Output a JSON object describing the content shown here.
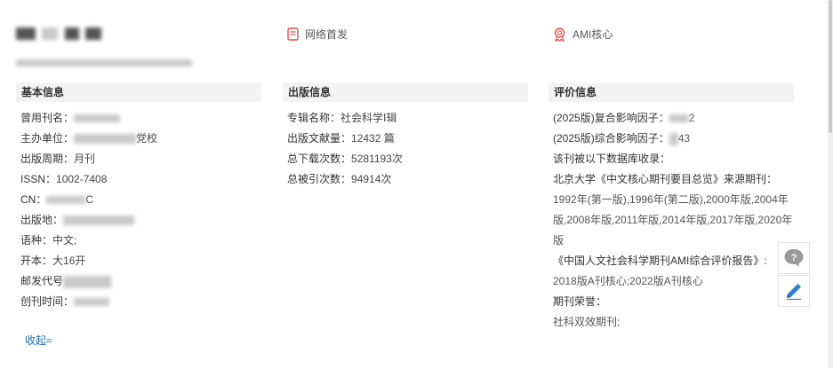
{
  "tags": {
    "network_first": "网络首发",
    "ami_core": "AMI核心"
  },
  "basic_info": {
    "heading": "基本信息",
    "rows": [
      {
        "label": "曾用刊名：",
        "value": ""
      },
      {
        "label": "主办单位：",
        "value": "党校"
      },
      {
        "label": "出版周期：",
        "value": "月刊"
      },
      {
        "label": "ISSN：",
        "value": "1002-7408"
      },
      {
        "label": "CN：",
        "value": "C"
      },
      {
        "label": "出版地：",
        "value": ""
      },
      {
        "label": "语种：",
        "value": "中文;"
      },
      {
        "label": "开本：",
        "value": "大16开"
      },
      {
        "label": "邮发代号",
        "value": ""
      },
      {
        "label": "创刊时间：",
        "value": ""
      }
    ],
    "collapse_label": "收起≈"
  },
  "publish_info": {
    "heading": "出版信息",
    "rows": [
      {
        "label": "专辑名称：",
        "value": "社会科学Ⅰ辑"
      },
      {
        "label": "出版文献量：",
        "value": "12432 篇"
      },
      {
        "label": "总下载次数：",
        "value": "5281193次"
      },
      {
        "label": "总被引次数：",
        "value": "94914次"
      }
    ]
  },
  "evaluation_info": {
    "heading": "评价信息",
    "composite_if": "(2025版)复合影响因子：",
    "composite_if_value": "2",
    "comprehensive_if": "(2025版)综合影响因子：",
    "comprehensive_if_value": "43",
    "db_intro": "该刊被以下数据库收录：",
    "pku_title": "北京大学《中文核心期刊要目总览》来源期刊：",
    "pku_years": [
      "1992年(第一版),1996年(第二版),2000年版,2004年",
      "版,2008年版,2011年版,2014年版,2017年版,2020年",
      "版"
    ],
    "ami_title": "《中国人文社会科学期刊AMI综合评价报告》:",
    "ami_years": "2018版A刊核心;2022版A刊核心",
    "honors_label": "期刊荣誉：",
    "honors_value": "社科双效期刊;"
  },
  "side_tools": {
    "feedback_icon": "question-bubble-icon",
    "edit_icon": "pencil-icon"
  },
  "colors": {
    "accent_red": "#e84c4c",
    "link_blue": "#1a6fb8",
    "section_bg": "#f3f3f3"
  }
}
